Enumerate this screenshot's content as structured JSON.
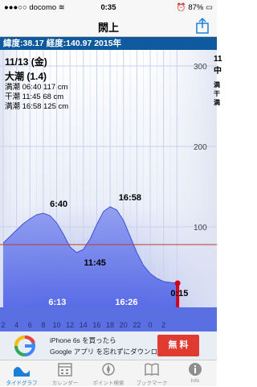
{
  "status": {
    "carrier": "docomo",
    "time": "0:35",
    "battery": "87%"
  },
  "nav": {
    "title": "閖上"
  },
  "coords": "緯度:38.17 経度:140.97  2015年",
  "info": {
    "date": "11/13 (金)",
    "tide_type": "大潮 (1.4)",
    "rows": [
      "満潮 06:40 117 cm",
      "干潮 11:45  68 cm",
      "満潮 16:58 125 cm"
    ]
  },
  "right_info": {
    "day": "11",
    "rows": [
      "中",
      "満",
      "干",
      "満"
    ]
  },
  "chart_data": {
    "type": "area",
    "x_ticks": [
      "2",
      "4",
      "6",
      "8",
      "10",
      "12",
      "14",
      "16",
      "18",
      "20",
      "22",
      "0",
      "2"
    ],
    "y_ticks": [
      "300",
      "200",
      "100"
    ],
    "ylim": [
      0,
      350
    ],
    "series": [
      {
        "values": [
          [
            -2,
            80
          ],
          [
            -1,
            88
          ],
          [
            0,
            96
          ],
          [
            1,
            104
          ],
          [
            2,
            110
          ],
          [
            3,
            115
          ],
          [
            4,
            117
          ],
          [
            5,
            114
          ],
          [
            6,
            105
          ],
          [
            7,
            91
          ],
          [
            8,
            75
          ],
          [
            9,
            68
          ],
          [
            10,
            72
          ],
          [
            11,
            85
          ],
          [
            12,
            103
          ],
          [
            13,
            119
          ],
          [
            14,
            125
          ],
          [
            15,
            121
          ],
          [
            16,
            108
          ],
          [
            17,
            88
          ],
          [
            18,
            68
          ],
          [
            19,
            52
          ],
          [
            20,
            42
          ],
          [
            21,
            36
          ],
          [
            22,
            32
          ],
          [
            23,
            31
          ],
          [
            24,
            30
          ]
        ]
      }
    ],
    "annotations": {
      "high1": "6:40",
      "low1": "11:45",
      "high2": "16:58",
      "low2": "0:15",
      "sunrise": "6:13",
      "sunset": "16:26"
    },
    "reference_line_cm": 78,
    "current_time_h": 24.1
  },
  "ad": {
    "line1": "iPhone 6s を買ったら",
    "line2": "Google アプリ を忘れずにダウンロード",
    "button": "無 料"
  },
  "tabs": [
    {
      "label": "タイドグラフ"
    },
    {
      "label": "カレンダー"
    },
    {
      "label": "ポイント検索"
    },
    {
      "label": "ブックマーク"
    },
    {
      "label": "Info"
    }
  ],
  "colors": {
    "accent": "#1a7fd6",
    "header": "#0f5a9e",
    "ad_button": "#e03b30"
  }
}
